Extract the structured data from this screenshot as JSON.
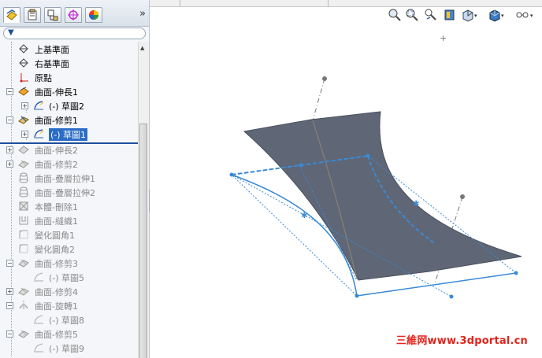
{
  "feature_tree": {
    "filter_icon": "funnel-icon",
    "items": [
      {
        "label": "上基準面",
        "icon": "plane-icon",
        "state": "normal"
      },
      {
        "label": "右基準面",
        "icon": "plane-icon",
        "state": "normal"
      },
      {
        "label": "原點",
        "icon": "origin-icon",
        "state": "normal"
      },
      {
        "label": "曲面-伸長1",
        "icon": "surface-extrude-icon",
        "state": "normal"
      },
      {
        "label": "(-) 草圖2",
        "icon": "sketch-icon",
        "state": "normal"
      },
      {
        "label": "曲面-修剪1",
        "icon": "surface-trim-icon",
        "state": "normal"
      },
      {
        "label": "(-) 草圖1",
        "icon": "sketch-icon",
        "state": "selected"
      },
      {
        "label": "曲面-伸長2",
        "icon": "surface-extrude-icon",
        "state": "suppressed"
      },
      {
        "label": "曲面-修剪2",
        "icon": "surface-trim-icon",
        "state": "suppressed"
      },
      {
        "label": "曲面-疊層拉伸1",
        "icon": "surface-loft-icon",
        "state": "suppressed"
      },
      {
        "label": "曲面-疊層拉伸2",
        "icon": "surface-loft-icon",
        "state": "suppressed"
      },
      {
        "label": "本體-刪除1",
        "icon": "delete-body-icon",
        "state": "suppressed"
      },
      {
        "label": "曲面-縫織1",
        "icon": "knit-icon",
        "state": "suppressed"
      },
      {
        "label": "變化圓角1",
        "icon": "fillet-icon",
        "state": "suppressed"
      },
      {
        "label": "變化圓角2",
        "icon": "fillet-icon",
        "state": "suppressed"
      },
      {
        "label": "曲面-修剪3",
        "icon": "surface-trim-icon",
        "state": "suppressed"
      },
      {
        "label": "(-) 草圖5",
        "icon": "sketch-icon",
        "state": "suppressed"
      },
      {
        "label": "曲面-修剪4",
        "icon": "surface-trim-icon",
        "state": "suppressed"
      },
      {
        "label": "曲面-旋轉1",
        "icon": "surface-revolve-icon",
        "state": "suppressed"
      },
      {
        "label": "(-) 草圖8",
        "icon": "sketch-icon",
        "state": "suppressed"
      },
      {
        "label": "曲面-修剪5",
        "icon": "surface-trim-icon",
        "state": "suppressed"
      },
      {
        "label": "(-) 草圖9",
        "icon": "sketch-icon",
        "state": "suppressed"
      }
    ]
  },
  "panel_tabs": [
    "feature-manager-tab",
    "property-manager-tab",
    "configuration-manager-tab",
    "dimxpert-tab",
    "display-manager-tab"
  ],
  "heads_up_toolbar": [
    "zoom-to-fit-icon",
    "zoom-to-area-icon",
    "previous-view-icon",
    "section-view-icon",
    "view-orientation-icon",
    "display-style-icon",
    "hide-show-items-icon"
  ],
  "colors": {
    "surface": "#5f6676",
    "sketch_blue": "#3a8ad6",
    "selection": "#2b6cc4",
    "watermark": "#e2231a"
  },
  "watermark": "三維网www.3dportal.cn"
}
